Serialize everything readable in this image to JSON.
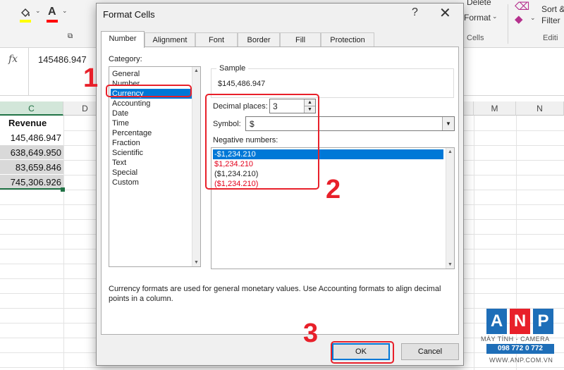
{
  "ribbon": {
    "delete_label": "Delete",
    "format_label": "Format",
    "cells_group": "Cells",
    "sort_label": "Sort &",
    "filter_label": "Filter",
    "editing_group": "Editi",
    "chevron": "⌄",
    "fill_color": "#ffff00",
    "font_color": "#ff0000"
  },
  "formula_bar": {
    "fx": "fx",
    "value": "145486.947"
  },
  "sheet": {
    "columns": [
      "C",
      "D",
      "",
      "",
      "",
      "",
      "",
      "",
      "M",
      "N"
    ],
    "header": "Revenue",
    "values": [
      "145,486.947",
      "638,649.950",
      "83,659.846",
      "745,306.926"
    ]
  },
  "dialog": {
    "title": "Format Cells",
    "help": "?",
    "close": "✕",
    "tabs": [
      "Number",
      "Alignment",
      "Font",
      "Border",
      "Fill",
      "Protection"
    ],
    "active_tab": "Number",
    "category_label": "Category:",
    "categories": [
      "General",
      "Number",
      "Currency",
      "Accounting",
      "Date",
      "Time",
      "Percentage",
      "Fraction",
      "Scientific",
      "Text",
      "Special",
      "Custom"
    ],
    "selected_category": "Currency",
    "sample_label": "Sample",
    "sample_value": "$145,486.947",
    "decimal_label": "Decimal places:",
    "decimal_value": "3",
    "symbol_label": "Symbol:",
    "symbol_value": "$",
    "negative_label": "Negative numbers:",
    "negative_options": [
      {
        "text": "-$1,234.210",
        "red": false
      },
      {
        "text": "$1,234.210",
        "red": true
      },
      {
        "text": "($1,234.210)",
        "red": false
      },
      {
        "text": "($1,234.210)",
        "red": true
      }
    ],
    "selected_negative": "-$1,234.210",
    "description": "Currency formats are used for general monetary values.  Use Accounting formats to align decimal points in a column.",
    "ok": "OK",
    "cancel": "Cancel"
  },
  "annotations": {
    "steps": [
      "1",
      "2",
      "3"
    ],
    "highlight_color": "#e8202a"
  },
  "watermark": {
    "letters": [
      "A",
      "N",
      "P"
    ],
    "colors": [
      "#1e6eb8",
      "#e8202a",
      "#1e6eb8"
    ],
    "tagline": "MÁY TÍNH - CAMERA",
    "phone": "098 772 0 772",
    "url": "WWW.ANP.COM.VN"
  }
}
